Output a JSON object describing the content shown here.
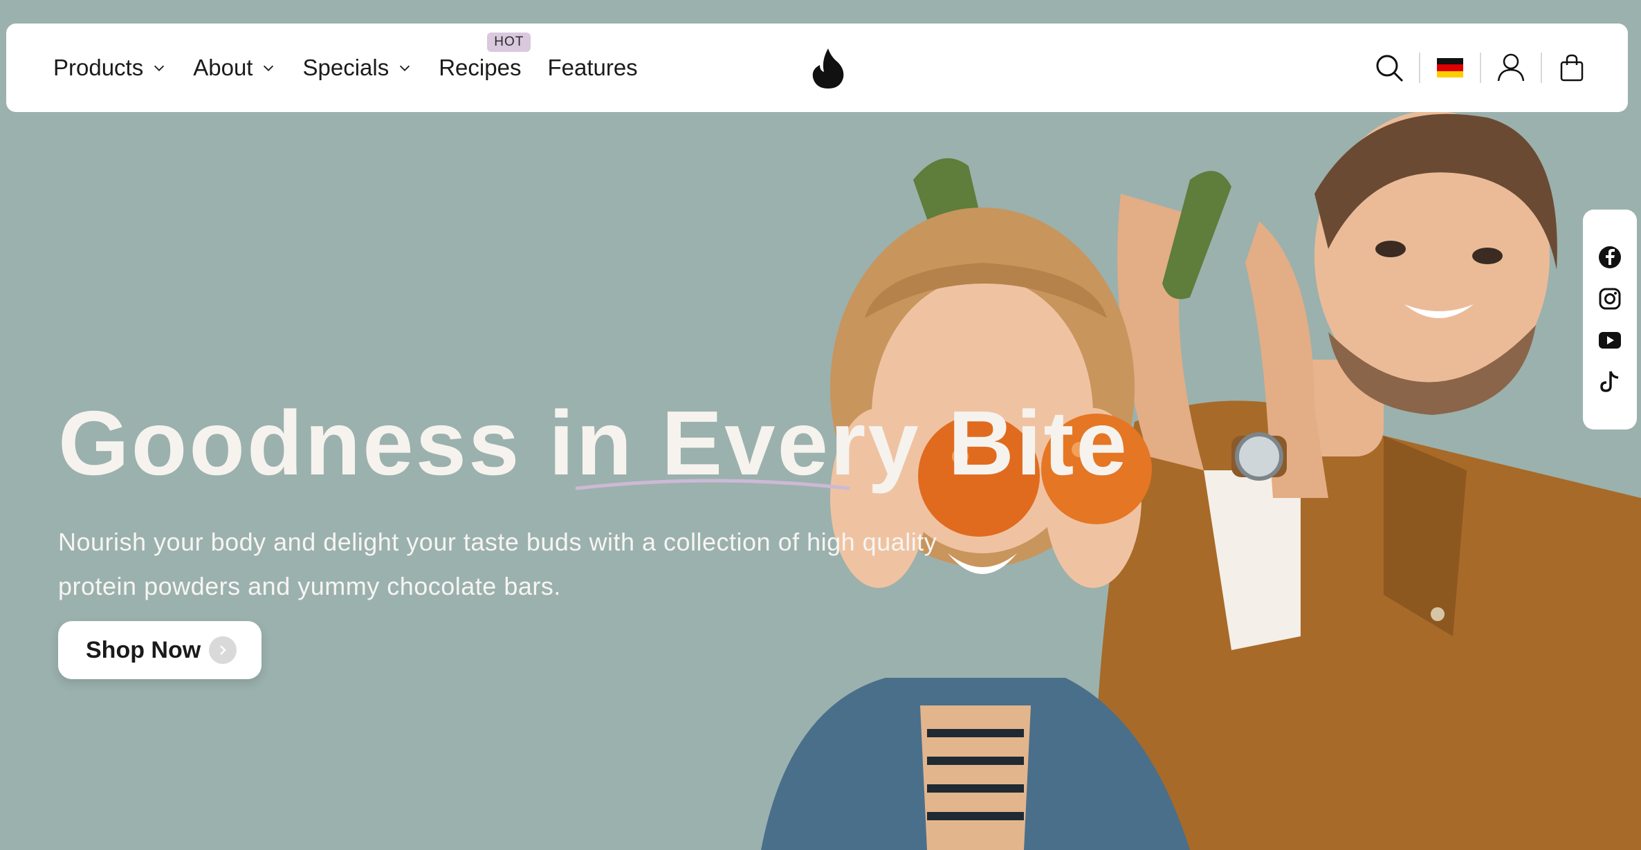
{
  "nav": {
    "items": [
      {
        "label": "Products",
        "dropdown": true
      },
      {
        "label": "About",
        "dropdown": true
      },
      {
        "label": "Specials",
        "dropdown": true
      },
      {
        "label": "Recipes",
        "badge": "HOT"
      },
      {
        "label": "Features"
      }
    ]
  },
  "header": {
    "logo_icon": "flame-icon",
    "icons": [
      "search-icon",
      "german-flag-icon",
      "account-icon",
      "cart-bag-icon"
    ],
    "language": "German"
  },
  "hero": {
    "headline": "Goodness in Every Bite",
    "subtitle": "Nourish your body and delight your taste buds with a collection of high quality protein powders and yummy chocolate bars.",
    "cta_label": "Shop Now",
    "image_icon": "couple-with-cucumbers-and-tomatoes-photo"
  },
  "social": {
    "icons": [
      "facebook-icon",
      "instagram-icon",
      "youtube-icon",
      "tiktok-icon"
    ]
  },
  "colors": {
    "background": "#9bb1ad",
    "header": "#ffffff",
    "badge": "#d9c8de",
    "text_dark": "#1b1b1b",
    "text_light": "#f6f3ef",
    "accent_underline": "#cdb9d6"
  }
}
